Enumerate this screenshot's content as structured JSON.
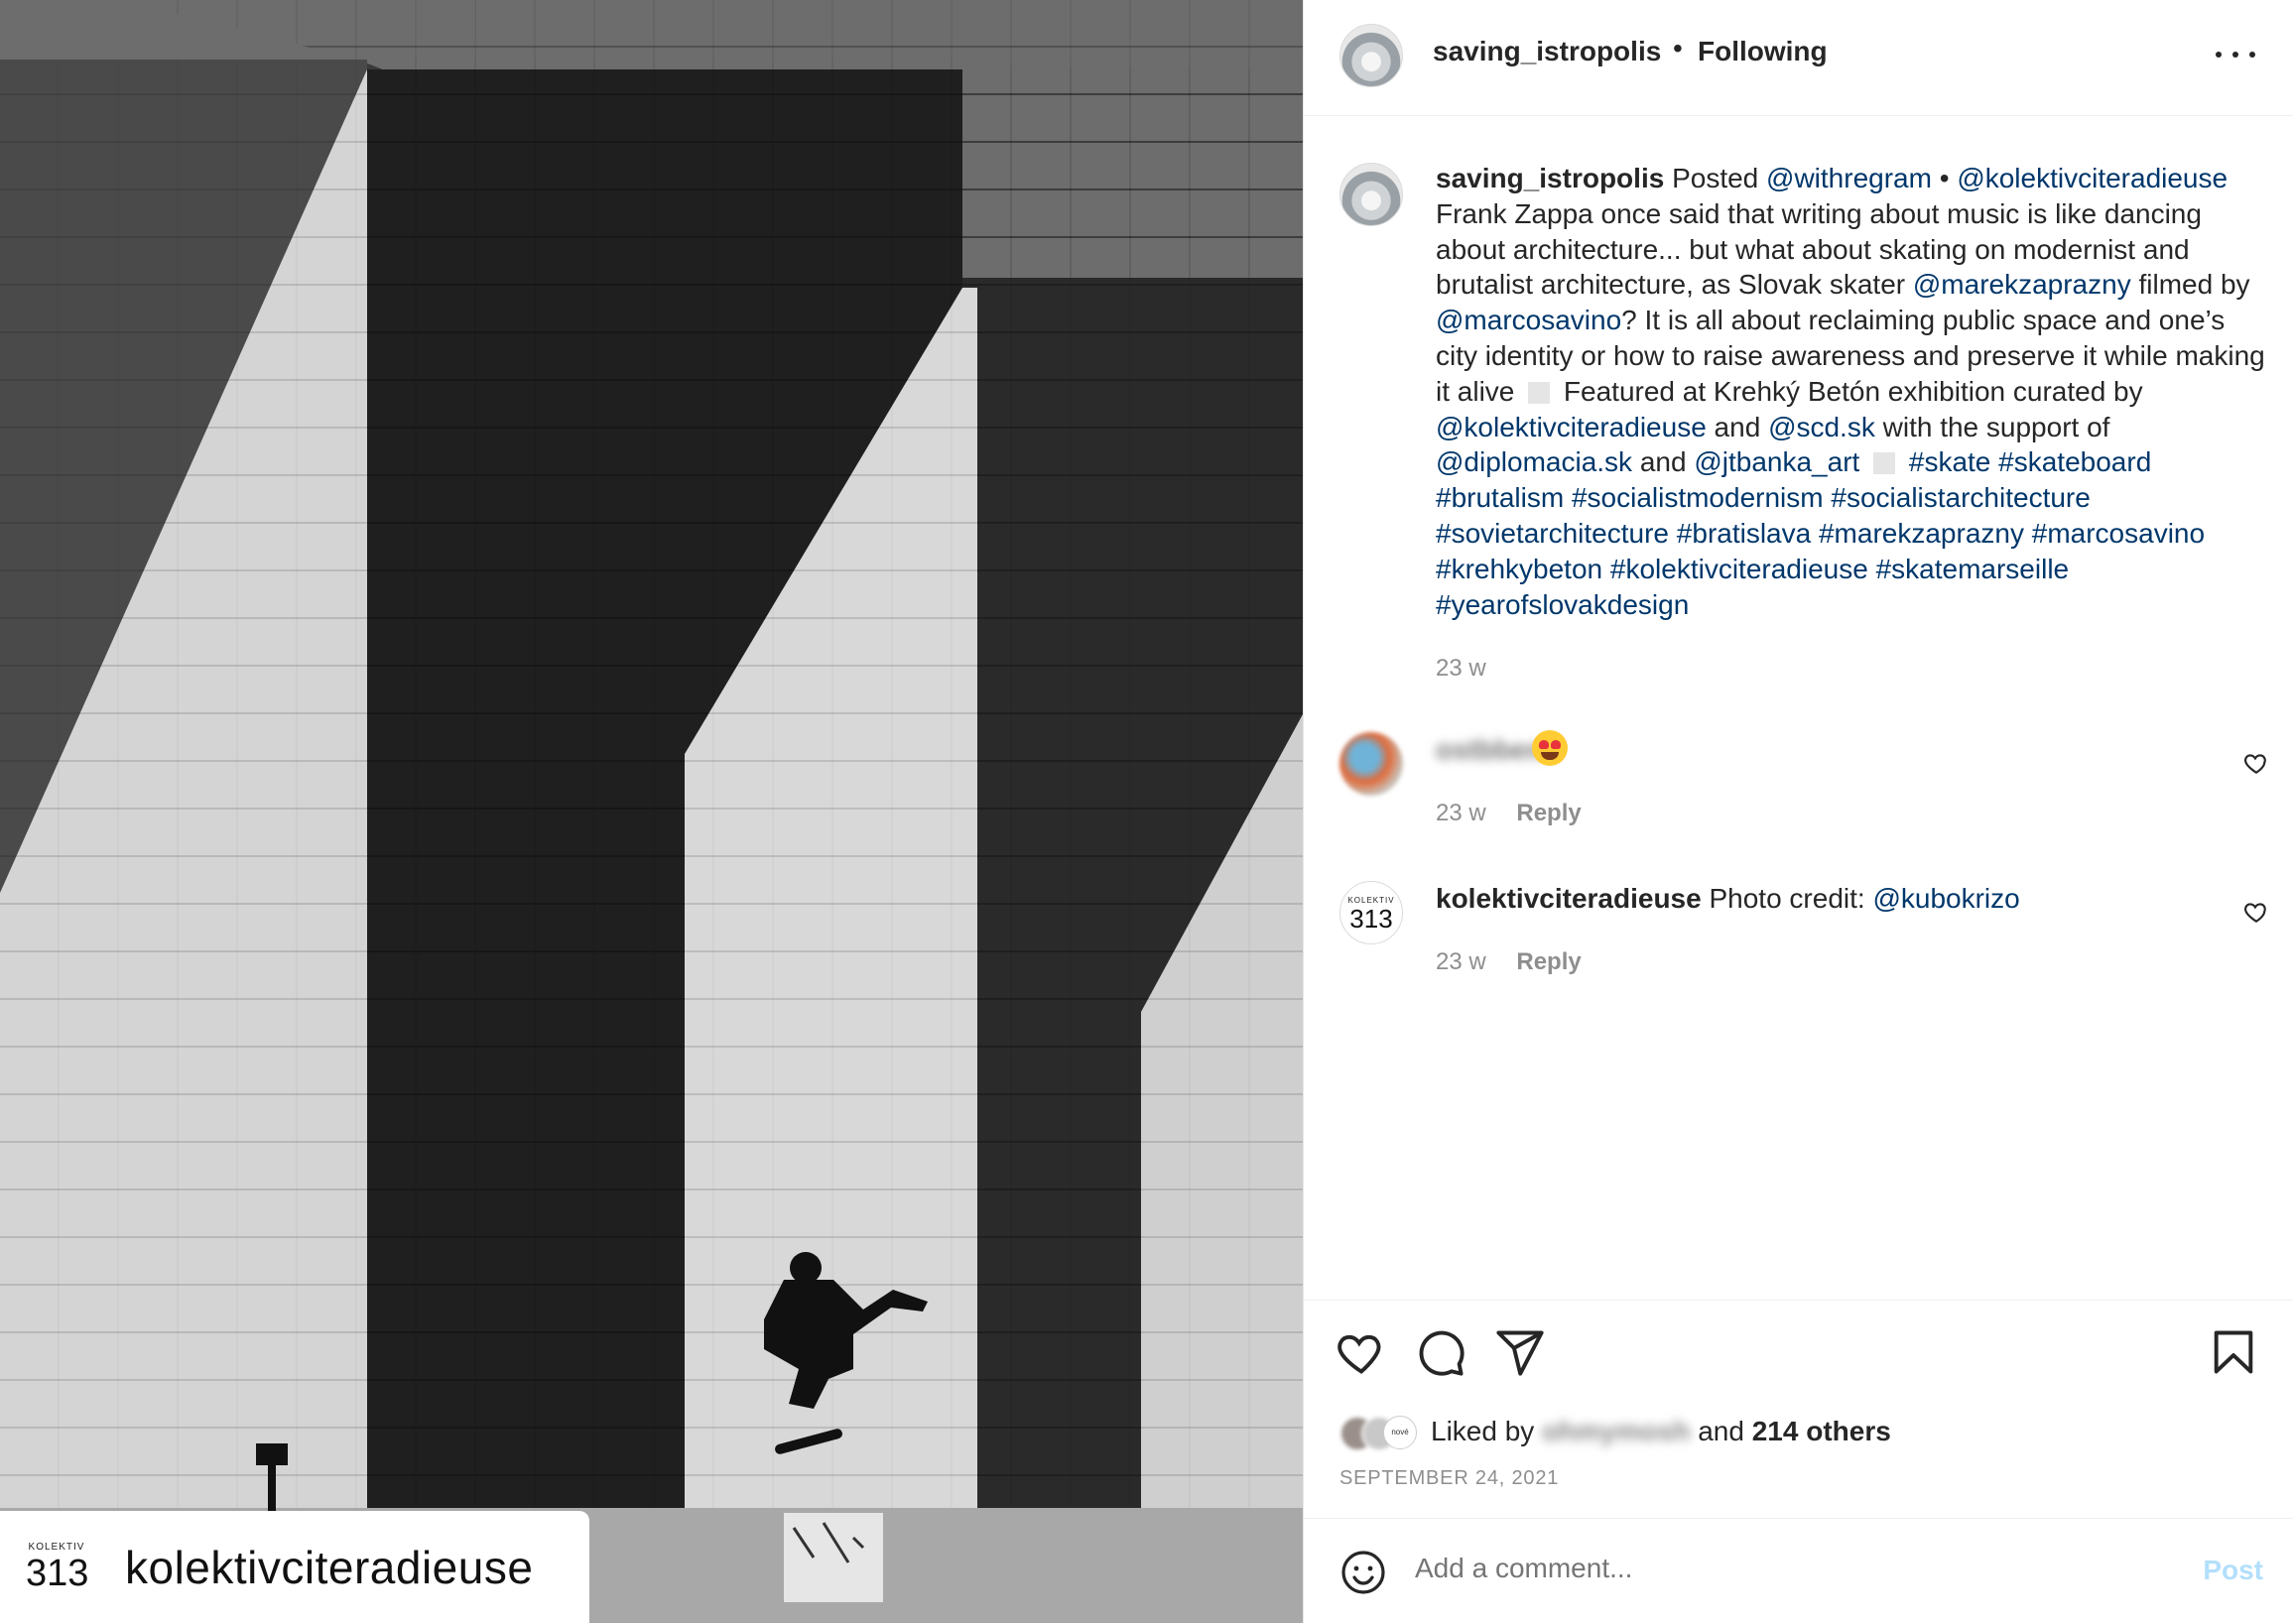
{
  "photo": {
    "alt_subject": "skater on brutalist building",
    "repost_badge": {
      "logo_small": "KOLEKTIV",
      "logo_big": "313",
      "name": "kolektivciteradieuse"
    }
  },
  "header": {
    "username": "saving_istropolis",
    "separator": "•",
    "follow_status": "Following",
    "more_icon": "more-horizontal-icon"
  },
  "caption": {
    "username": "saving_istropolis",
    "segments": [
      {
        "t": "Posted ",
        "c": "text"
      },
      {
        "t": "@withregram",
        "c": "link"
      },
      {
        "t": " • ",
        "c": "text"
      },
      {
        "t": "@kolektivciteradieuse",
        "c": "link"
      },
      {
        "t": " Frank Zappa once said that writing about music is like dancing about architecture... but what about skating on modernist and brutalist architecture, as Slovak skater ",
        "c": "text"
      },
      {
        "t": "@marekzaprazny",
        "c": "link"
      },
      {
        "t": " filmed by ",
        "c": "text"
      },
      {
        "t": "@marcosavino",
        "c": "link"
      },
      {
        "t": "? It is all about reclaiming public space and one’s city identity or how to raise awareness and preserve it while making it alive ",
        "c": "text"
      },
      {
        "t": "",
        "c": "square"
      },
      {
        "t": " Featured at Krehký Betón exhibition curated by ",
        "c": "text"
      },
      {
        "t": "@kolektivciteradieuse",
        "c": "link"
      },
      {
        "t": " and ",
        "c": "text"
      },
      {
        "t": "@scd.sk",
        "c": "link"
      },
      {
        "t": " with the support of ",
        "c": "text"
      },
      {
        "t": "@diplomacia.sk",
        "c": "link"
      },
      {
        "t": " and ",
        "c": "text"
      },
      {
        "t": "@jtbanka_art",
        "c": "link"
      },
      {
        "t": " ",
        "c": "text"
      },
      {
        "t": "",
        "c": "square"
      },
      {
        "t": " ",
        "c": "text"
      },
      {
        "t": "#skate",
        "c": "link"
      },
      {
        "t": " ",
        "c": "text"
      },
      {
        "t": "#skateboard",
        "c": "link"
      },
      {
        "t": " ",
        "c": "text"
      },
      {
        "t": "#brutalism",
        "c": "link"
      },
      {
        "t": " ",
        "c": "text"
      },
      {
        "t": "#socialistmodernism",
        "c": "link"
      },
      {
        "t": " ",
        "c": "text"
      },
      {
        "t": "#socialistarchitecture",
        "c": "link"
      },
      {
        "t": " ",
        "c": "text"
      },
      {
        "t": "#sovietarchitecture",
        "c": "link"
      },
      {
        "t": " ",
        "c": "text"
      },
      {
        "t": "#bratislava",
        "c": "link"
      },
      {
        "t": " ",
        "c": "text"
      },
      {
        "t": "#marekzaprazny",
        "c": "link"
      },
      {
        "t": " ",
        "c": "text"
      },
      {
        "t": "#marcosavino",
        "c": "link"
      },
      {
        "t": " ",
        "c": "text"
      },
      {
        "t": "#krehkybeton",
        "c": "link"
      },
      {
        "t": " ",
        "c": "text"
      },
      {
        "t": "#kolektivciteradieuse",
        "c": "link"
      },
      {
        "t": " ",
        "c": "text"
      },
      {
        "t": "#skatemarseille",
        "c": "link"
      },
      {
        "t": " ",
        "c": "text"
      },
      {
        "t": "#yearofslovakdesign",
        "c": "link"
      }
    ],
    "time": "23 w"
  },
  "comments": [
    {
      "username_blurred": "ostbbem",
      "emoji": "heart-eyes-emoji",
      "time": "23 w",
      "reply": "Reply"
    },
    {
      "avatar_small": "KOLEKTIV",
      "avatar_big": "313",
      "username": "kolektivciteradieuse",
      "text": "Photo credit: ",
      "mention": "@kubokrizo",
      "time": "23 w",
      "reply": "Reply"
    }
  ],
  "actions": {
    "icons": [
      "heart-icon",
      "comment-icon",
      "share-icon",
      "bookmark-icon"
    ],
    "liked_by_prefix": "Liked by ",
    "liked_by_user_blurred": "ohmymosh",
    "liked_by_mid": " and ",
    "liked_by_count": "214 others",
    "liker_badge": "nové",
    "date": "SEPTEMBER 24, 2021"
  },
  "add_comment": {
    "placeholder": "Add a comment...",
    "post_label": "Post",
    "post_color": "#b2dffc"
  },
  "colors": {
    "link": "#00376b",
    "muted": "#8e8e8e",
    "text": "#262626"
  }
}
